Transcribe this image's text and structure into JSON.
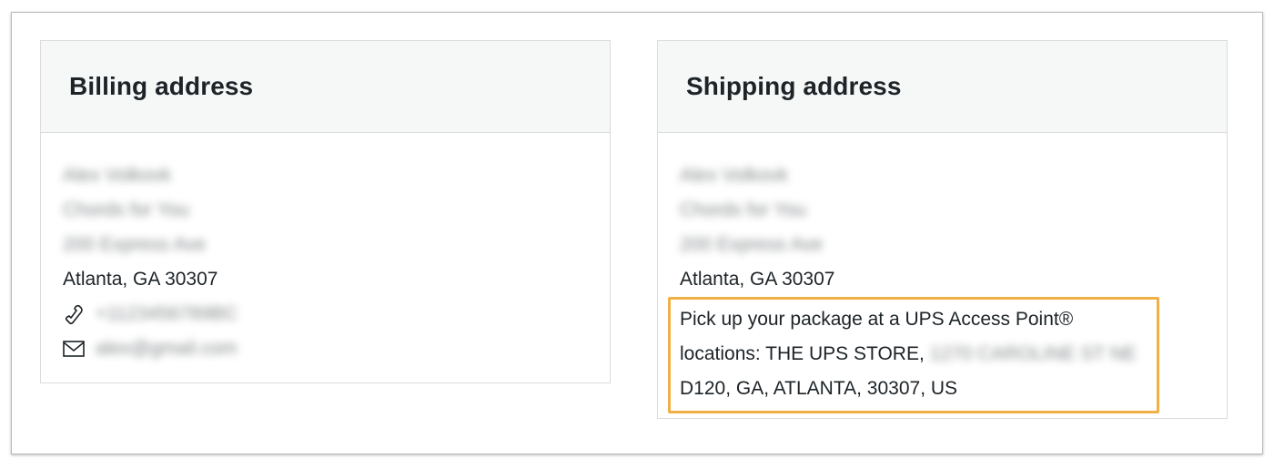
{
  "billing": {
    "title": "Billing address",
    "name": "Alex Volkovk",
    "company": "Chords for You",
    "street": "200 Express Ave",
    "city_line": "Atlanta, GA 30307",
    "phone": "+1123456789BC",
    "email": "alex@gmail.com"
  },
  "shipping": {
    "title": "Shipping address",
    "name": "Alex Volkovk",
    "company": "Chords for You",
    "street": "200 Express Ave",
    "city_line": "Atlanta, GA 30307",
    "ups_line1": "Pick up your package at a UPS Access Point®",
    "ups_line2_prefix": "locations: THE UPS STORE,",
    "ups_line2_blurred": "1270 CAROLINE ST NE",
    "ups_line3": "D120, GA, ATLANTA, 30307, US"
  },
  "icons": {
    "phone": "phone-icon",
    "email": "envelope-icon"
  },
  "colors": {
    "highlight": "#f0b045",
    "header_bg": "#f6f7f7",
    "border": "#dcdcde",
    "text": "#1d2327"
  }
}
